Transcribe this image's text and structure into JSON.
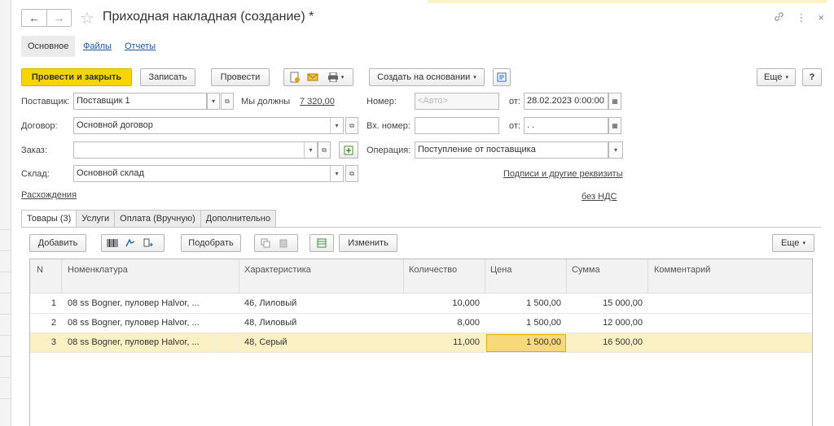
{
  "window": {
    "title": "Приходная накладная (создание) *",
    "back_icon": "←",
    "forward_icon": "→",
    "star_icon": "☆",
    "link_icon": "🔗",
    "more_icon": "⋮",
    "close_icon": "×"
  },
  "form_tabs": [
    {
      "label": "Основное",
      "active": true
    },
    {
      "label": "Файлы",
      "active": false
    },
    {
      "label": "Отчеты",
      "active": false
    }
  ],
  "toolbar": {
    "post_close_label": "Провести и закрыть",
    "write_label": "Записать",
    "post_label": "Провести",
    "create_based_label": "Создать на основании",
    "more_label": "Еще",
    "help_label": "?"
  },
  "fields": {
    "supplier_label": "Поставщик:",
    "supplier_value": "Поставщик 1",
    "we_owe_label": "Мы должны",
    "we_owe_value": "7 320,00",
    "number_label": "Номер:",
    "number_placeholder": "<Авто>",
    "from_label": "от:",
    "date_value": "28.02.2023  0:00:00",
    "contract_label": "Договор:",
    "contract_value": "Основной договор",
    "in_number_label": "Вх. номер:",
    "in_number_value": "",
    "in_from_label": "от:",
    "in_date_value": " .  .",
    "order_label": "Заказ:",
    "order_value": "",
    "operation_label": "Операция:",
    "operation_value": "Поступление от поставщика",
    "warehouse_label": "Склад:",
    "warehouse_value": "Основной склад",
    "signatures_link": "Подписи и другие реквизиты",
    "discrepancies_link": "Расхождения",
    "vat_link": "без НДС"
  },
  "content_tabs": [
    {
      "label": "Товары (3)",
      "active": true
    },
    {
      "label": "Услуги",
      "active": false
    },
    {
      "label": "Оплата (Вручную)",
      "active": false
    },
    {
      "label": "Дополнительно",
      "active": false
    }
  ],
  "table_toolbar": {
    "add_label": "Добавить",
    "pick_label": "Подобрать",
    "change_label": "Изменить",
    "more_label": "Еще"
  },
  "table": {
    "columns": [
      "N",
      "Номенклатура",
      "Характеристика",
      "Количество",
      "Цена",
      "Сумма",
      "Комментарий"
    ],
    "rows": [
      {
        "n": "1",
        "item": "08 ss Bogner, пуловер Halvor, ...",
        "characteristic": "46, Лиловый",
        "qty": "10,000",
        "price": "1 500,00",
        "sum": "15 000,00",
        "comment": "",
        "selected": false
      },
      {
        "n": "2",
        "item": "08 ss Bogner, пуловер Halvor, ...",
        "characteristic": "48, Лиловый",
        "qty": "8,000",
        "price": "1 500,00",
        "sum": "12 000,00",
        "comment": "",
        "selected": false
      },
      {
        "n": "3",
        "item": "08 ss Bogner, пуловер Halvor, ...",
        "characteristic": "48, Серый",
        "qty": "11,000",
        "price": "1 500,00",
        "sum": "16 500,00",
        "comment": "",
        "selected": true
      }
    ]
  },
  "colors": {
    "primary_button": "#f8d400",
    "selected_row": "#fcf1c4",
    "selected_cell": "#f8d97a",
    "link": "#1a55a6"
  }
}
